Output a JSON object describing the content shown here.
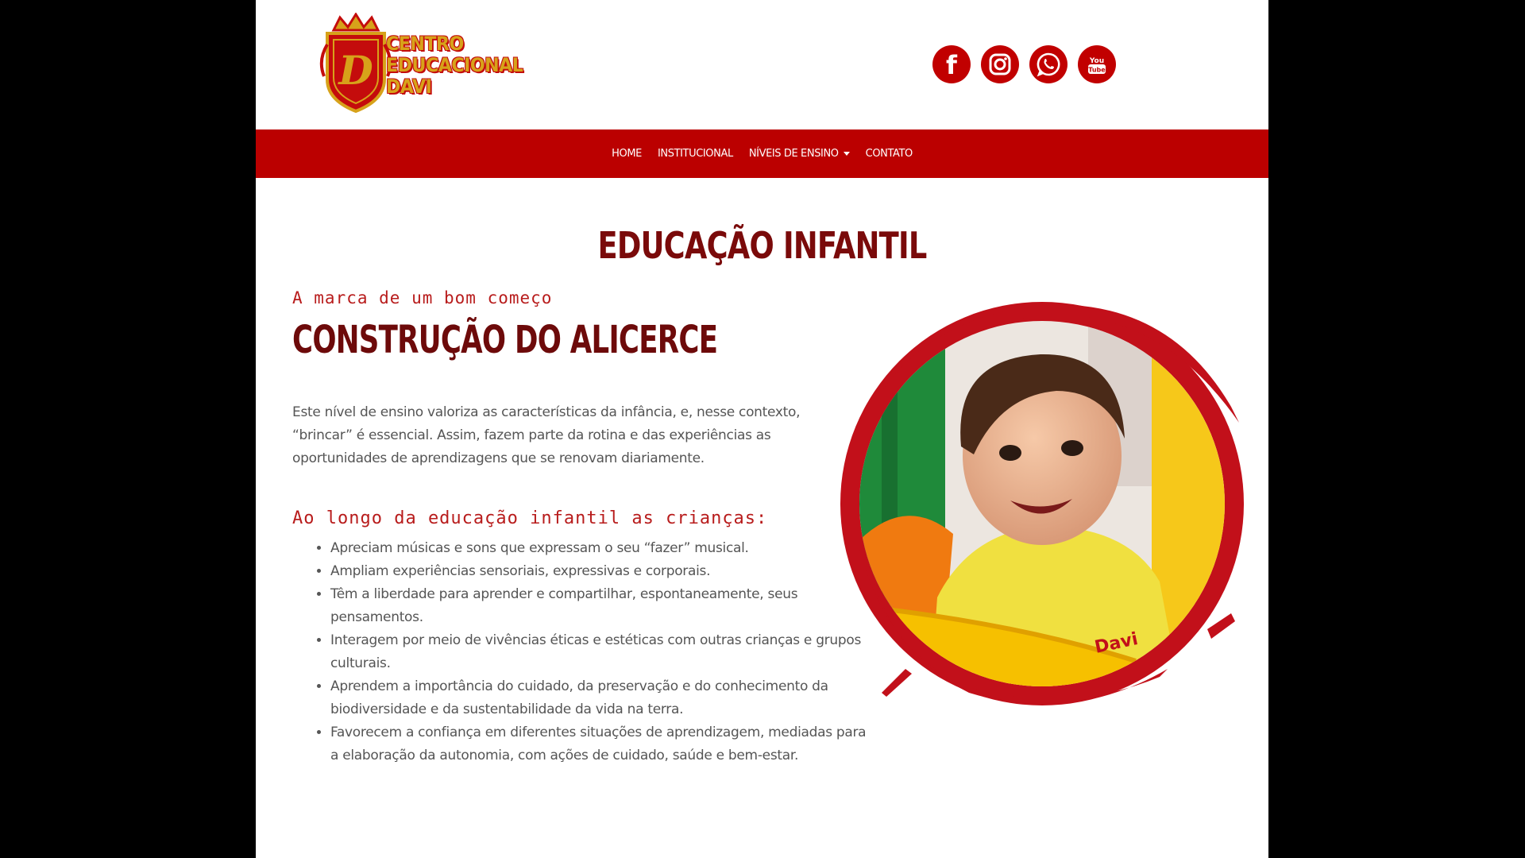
{
  "colors": {
    "brand_red": "#bb0000",
    "dark_red": "#6d0a0a",
    "accent_gold": "#d7a21a",
    "text_gray": "#555555"
  },
  "logo": {
    "line1": "CENTRO",
    "line2": "EDUCACIONAL",
    "line3": "DAVI",
    "monogram": "D"
  },
  "social": [
    {
      "name": "facebook",
      "glyph": "f"
    },
    {
      "name": "instagram"
    },
    {
      "name": "whatsapp"
    },
    {
      "name": "youtube",
      "glyph": "You Tube"
    }
  ],
  "nav": {
    "home": "HOME",
    "institucional": "INSTITUCIONAL",
    "niveis": "NÍVEIS DE ENSINO",
    "contato": "CONTATO"
  },
  "content": {
    "page_title": "EDUCAÇÃO INFANTIL",
    "subtitle": "A marca de um bom começo",
    "section_title": "CONSTRUÇÃO DO ALICERCE",
    "intro": "Este nível de ensino valoriza as características da infância, e, nesse contexto, “brincar” é essencial. Assim, fazem parte da rotina e das experiências as oportunidades de aprendizagens que se renovam diariamente.",
    "list_heading": "Ao longo da educação infantil as crianças:",
    "list_items": [
      "Apreciam músicas e sons que expressam o seu “fazer” musical.",
      "Ampliam experiências sensoriais, expressivas e corporais.",
      "Têm a liberdade para aprender e compartilhar, espontaneamente, seus pensamentos.",
      "Interagem por meio de vivências éticas e estéticas com outras crianças e grupos culturais.",
      "Aprendem a importância do cuidado, da preservação e do conhecimento da biodiversidade e da sustentabilidade da vida na terra.",
      "Favorecem a confiança em diferentes situações de aprendizagem, mediadas para a elaboração da autonomia, com ações de cuidado, saúde e bem-estar."
    ]
  },
  "photo": {
    "shirt_text": "Davi"
  }
}
